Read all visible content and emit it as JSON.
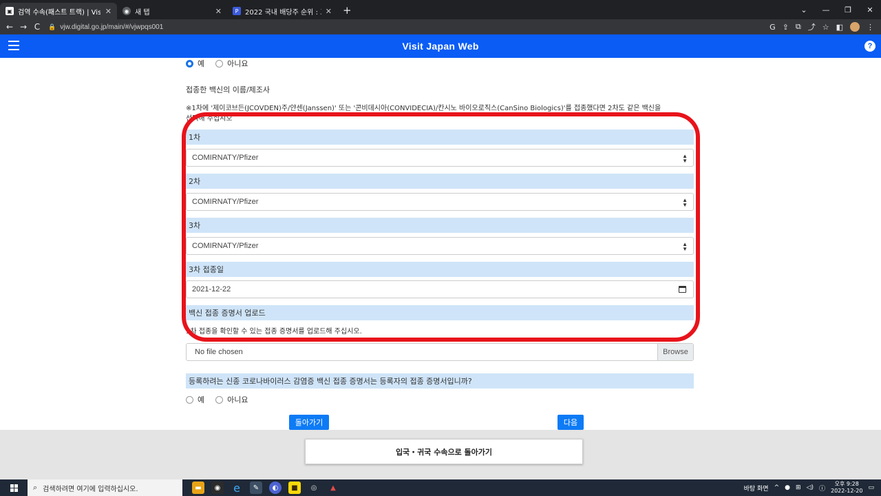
{
  "browser": {
    "tabs": [
      {
        "label": "검역 수속(패스트 트랙) | Visit Ja",
        "active": true
      },
      {
        "label": "새 탭",
        "active": false
      },
      {
        "label": "2022 국내 배당주 순위 : 고배당",
        "active": false
      }
    ],
    "url": "vjw.digital.go.jp/main/#/vjwpqs001"
  },
  "header": {
    "title": "Visit Japan Web"
  },
  "form": {
    "top_radio": {
      "yes": "예",
      "no": "아니요"
    },
    "vaccine_name_label": "접종한 백신의 이름/제조사",
    "vaccine_note": "※1차에 '제이코브든(JCOVDEN)주/얀센(Janssen)' 또는 '콘비데시아(CONVIDECIA)/칸시노 바이오로직스(CanSino Biologics)'를 접종했다면 2차도 같은 백신을",
    "vaccine_note_2": "선택해 주십시오",
    "dose1": {
      "label": "1차",
      "value": "COMIRNATY/Pfizer"
    },
    "dose2": {
      "label": "2차",
      "value": "COMIRNATY/Pfizer"
    },
    "dose3": {
      "label": "3차",
      "value": "COMIRNATY/Pfizer"
    },
    "dose3_date": {
      "label": "3차 접종일",
      "value": "2021-12-22"
    },
    "upload": {
      "label": "백신 접종 증명서 업로드",
      "instruction": "3차 접종을 확인할 수 있는 접종 증명서를 업로드해 주십시오.",
      "file_placeholder": "No file chosen",
      "browse_label": "Browse"
    },
    "new_corona_question": "등록하려는 신종 코로나바이러스 감염증 백신 접종 증명서는 등록자의 접종 증명서입니까?",
    "bottom_radio": {
      "yes": "예",
      "no": "아니요"
    },
    "back_button": "돌아가기",
    "next_button": "다음"
  },
  "footer": {
    "return_button": "입국・귀국 수속으로 돌아가기"
  },
  "taskbar": {
    "search_placeholder": "검색하려면 여기에 입력하십시오.",
    "desktop_label": "바탕 화면",
    "time": "오후 9:28",
    "date": "2022-12-20"
  },
  "colors": {
    "header_blue": "#0a5cf5",
    "section_bg": "#cfe4f8",
    "highlight_red": "#e8131b",
    "button_blue": "#0d7bf5"
  }
}
